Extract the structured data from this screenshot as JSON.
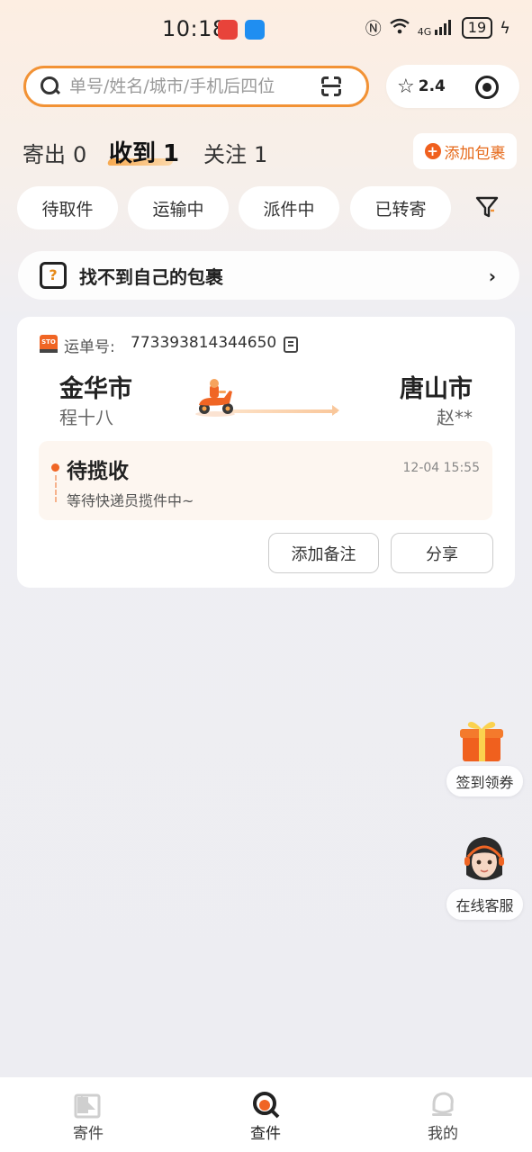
{
  "status_bar": {
    "time": "10:18",
    "network": "4G",
    "battery": "19"
  },
  "search": {
    "placeholder": "单号/姓名/城市/手机后四位"
  },
  "rating": "2.4",
  "tabs": [
    {
      "label": "寄出",
      "count": "0"
    },
    {
      "label": "收到",
      "count": "1"
    },
    {
      "label": "关注",
      "count": "1"
    }
  ],
  "add_package_label": "添加包裹",
  "filters": [
    "待取件",
    "运输中",
    "派件中",
    "已转寄"
  ],
  "not_found_label": "找不到自己的包裹",
  "card": {
    "carrier_logo": "STO",
    "waybill_label": "运单号:",
    "waybill_number": "773393814344650",
    "from_city": "金华市",
    "from_name": "程十八",
    "to_city": "唐山市",
    "to_name": "赵**",
    "status": "待揽收",
    "status_time": "12-04 15:55",
    "status_desc": "等待快递员揽件中~",
    "btn_note": "添加备注",
    "btn_share": "分享"
  },
  "floating": {
    "checkin": "签到领券",
    "service": "在线客服"
  },
  "nav": [
    {
      "label": "寄件"
    },
    {
      "label": "查件"
    },
    {
      "label": "我的"
    }
  ],
  "colors": {
    "accent": "#f29235",
    "brand_orange": "#f06524"
  }
}
